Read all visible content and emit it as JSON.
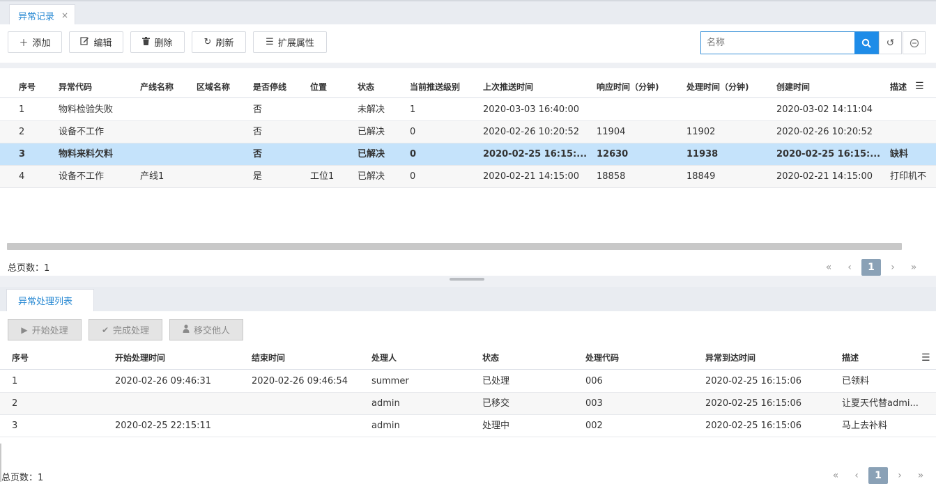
{
  "top_tab": {
    "label": "异常记录",
    "close": "×"
  },
  "toolbar": {
    "add": "添加",
    "edit": "编辑",
    "delete": "删除",
    "refresh": "刷新",
    "ext": "扩展属性",
    "search_placeholder": "名称"
  },
  "grid1": {
    "columns": [
      "序号",
      "异常代码",
      "产线名称",
      "区域名称",
      "是否停线",
      "位置",
      "状态",
      "当前推送级别",
      "上次推送时间",
      "响应时间（分钟)",
      "处理时间（分钟)",
      "创建时间",
      "描述"
    ],
    "rows": [
      [
        "1",
        "物料检验失败",
        "",
        "",
        "否",
        "",
        "未解决",
        "1",
        "2020-03-03 16:40:00",
        "",
        "",
        "2020-03-02 14:11:04",
        ""
      ],
      [
        "2",
        "设备不工作",
        "",
        "",
        "否",
        "",
        "已解决",
        "0",
        "2020-02-26 10:20:52",
        "11904",
        "11902",
        "2020-02-26 10:20:52",
        ""
      ],
      [
        "3",
        "物料来料欠料",
        "",
        "",
        "否",
        "",
        "已解决",
        "0",
        "2020-02-25 16:15:...",
        "12630",
        "11938",
        "2020-02-25 16:15:...",
        "缺料"
      ],
      [
        "4",
        "设备不工作",
        "产线1",
        "",
        "是",
        "工位1",
        "已解决",
        "0",
        "2020-02-21 14:15:00",
        "18858",
        "18849",
        "2020-02-21 14:15:00",
        "打印机不"
      ]
    ],
    "selected_row": 3,
    "total_label": "总页数：1",
    "current_page": "1"
  },
  "bottom_tab": {
    "label": "异常处理列表"
  },
  "bottom_toolbar": {
    "start": "开始处理",
    "finish": "完成处理",
    "transfer": "移交他人"
  },
  "grid2": {
    "columns": [
      "序号",
      "开始处理时间",
      "结束时间",
      "处理人",
      "状态",
      "处理代码",
      "异常到达时间",
      "描述"
    ],
    "rows": [
      [
        "1",
        "2020-02-26 09:46:31",
        "2020-02-26 09:46:54",
        "summer",
        "已处理",
        "006",
        "2020-02-25 16:15:06",
        "已领料"
      ],
      [
        "2",
        "",
        "",
        "admin",
        "已移交",
        "003",
        "2020-02-25 16:15:06",
        "让夏天代替admi..."
      ],
      [
        "3",
        "2020-02-25 22:15:11",
        "",
        "admin",
        "处理中",
        "002",
        "2020-02-25 16:15:06",
        "马上去补料"
      ]
    ],
    "total_label": "总页数：1",
    "current_page": "1"
  },
  "pager": {
    "first": "«",
    "prev": "‹",
    "next": "›",
    "last": "»"
  },
  "colors": {
    "accent": "#1e8ce8",
    "selected_row": "#c5e3fb",
    "tab_text": "#2a8ad3"
  },
  "icons": {
    "add": "plus-icon",
    "edit": "edit-icon",
    "delete": "trash-icon",
    "refresh": "refresh-icon",
    "ext": "list-icon",
    "search": "search-icon",
    "reset": "reset-icon",
    "collapse": "minus-circle-icon",
    "menu": "menu-icon",
    "play": "play-icon",
    "check": "check-icon",
    "user": "user-icon"
  }
}
